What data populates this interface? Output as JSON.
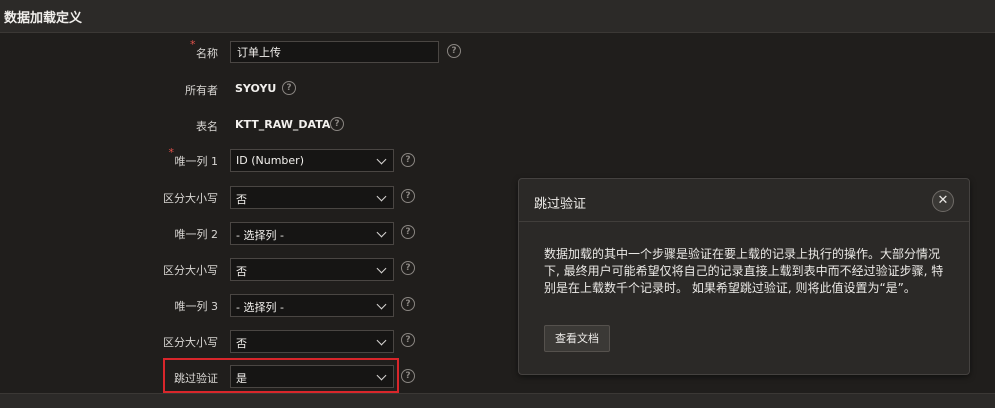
{
  "header": {
    "title": "数据加载定义"
  },
  "fields": {
    "name": {
      "label": "名称",
      "value": "订单上传",
      "required": "*"
    },
    "owner": {
      "label": "所有者",
      "value": "SYOYU"
    },
    "table": {
      "label": "表名",
      "value": "KTT_RAW_DATA"
    },
    "unique1": {
      "label": "唯一列 1",
      "value": "ID (Number)",
      "required": "*"
    },
    "case1": {
      "label": "区分大小写",
      "value": "否"
    },
    "unique2": {
      "label": "唯一列 2",
      "value": "- 选择列 -"
    },
    "case2": {
      "label": "区分大小写",
      "value": "否"
    },
    "unique3": {
      "label": "唯一列 3",
      "value": "- 选择列 -"
    },
    "case3": {
      "label": "区分大小写",
      "value": "否"
    },
    "skip_validation": {
      "label": "跳过验证",
      "value": "是"
    }
  },
  "help_glyph": "?",
  "popup": {
    "title": "跳过验证",
    "close_glyph": "✕",
    "body": "数据加载的其中一个步骤是验证在要上载的记录上执行的操作。大部分情况下, 最终用户可能希望仅将自己的记录直接上载到表中而不经过验证步骤, 特别是在上载数千个记录时。 如果希望跳过验证, 则将此值设置为“是”。",
    "button_label": "查看文档"
  },
  "colors": {
    "background": "#201e1c",
    "highlight_border": "#d9262b",
    "required_marker": "#e2524b"
  }
}
